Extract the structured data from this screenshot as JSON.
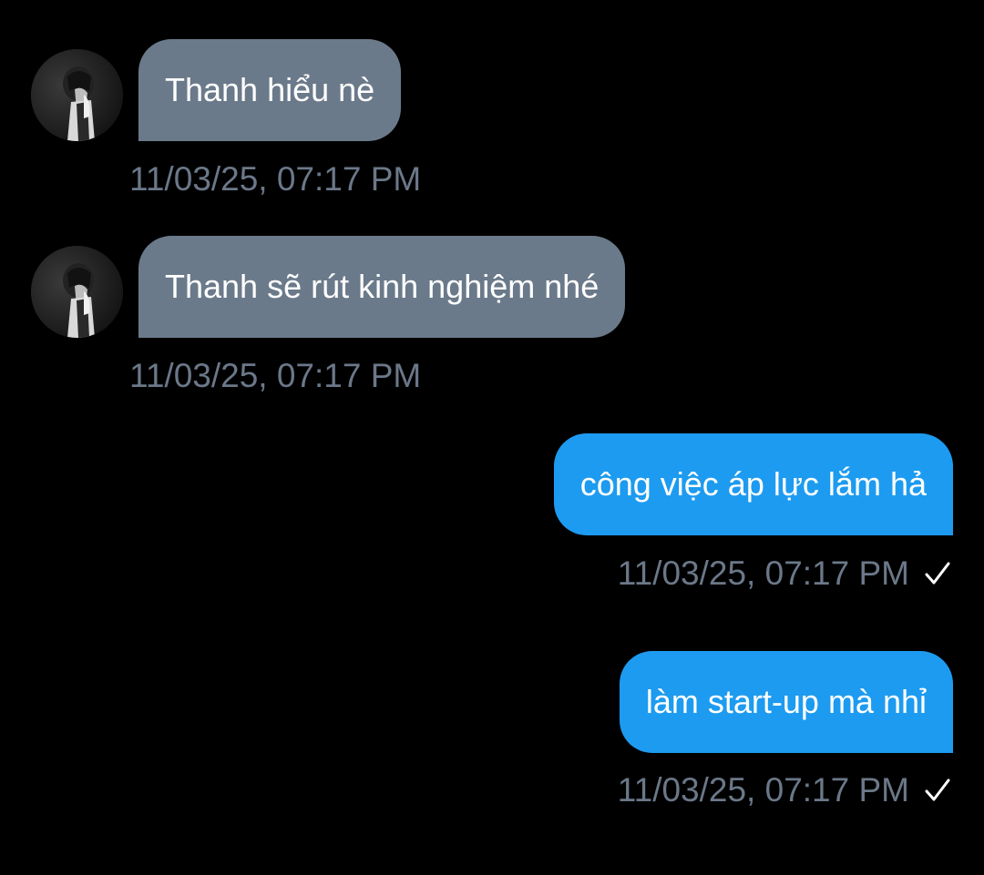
{
  "conversation": {
    "messages": [
      {
        "direction": "incoming",
        "text": "Thanh hiểu nè",
        "timestamp": "11/03/25, 07:17 PM",
        "avatar_icon": "user-avatar-photo"
      },
      {
        "direction": "incoming",
        "text": "Thanh sẽ rút kinh nghiệm nhé",
        "timestamp": "11/03/25, 07:17 PM",
        "avatar_icon": "user-avatar-photo"
      },
      {
        "direction": "outgoing",
        "text": "công việc áp lực lắm hả",
        "timestamp": "11/03/25, 07:17 PM",
        "status_icon": "check-icon"
      },
      {
        "direction": "outgoing",
        "text": "làm start-up mà nhỉ",
        "timestamp": "11/03/25, 07:17 PM",
        "status_icon": "check-icon"
      }
    ]
  },
  "colors": {
    "background": "#000000",
    "incoming_bubble": "#6b7a8a",
    "outgoing_bubble": "#1d9bf0",
    "bubble_text": "#ffffff",
    "timestamp": "#6b7889",
    "check": "#ffffff"
  }
}
